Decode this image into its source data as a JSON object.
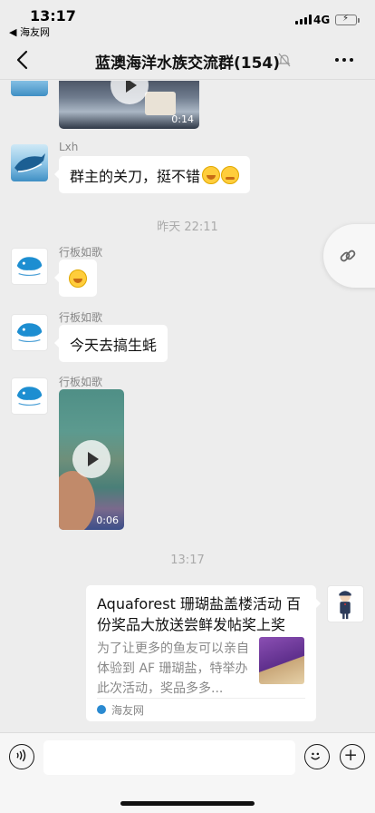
{
  "status_bar": {
    "time": "13:17",
    "back_app": "◀ 海友网",
    "network": "4G",
    "battery_color": "#3ec553"
  },
  "nav": {
    "title": "蓝澳海洋水族交流群(154)",
    "back_icon": "chevron-left-icon",
    "mute_icon": "bell-off-icon",
    "more_icon": "more-dots-icon"
  },
  "messages": [
    {
      "type": "video",
      "duration": "0:14"
    },
    {
      "type": "text",
      "sender": "Lxh",
      "text": "群主的关刀，挺不错",
      "emojis": [
        "grimace-emoji",
        "dizzy-emoji"
      ]
    },
    {
      "type": "timestamp",
      "text": "昨天 22:11"
    },
    {
      "type": "emoji",
      "sender": "行板如歌",
      "emoji": "grimace-emoji"
    },
    {
      "type": "text",
      "sender": "行板如歌",
      "text": "今天去搞生蚝"
    },
    {
      "type": "video",
      "sender": "行板如歌",
      "duration": "0:06"
    },
    {
      "type": "timestamp",
      "text": "13:17"
    }
  ],
  "card": {
    "title": "Aquaforest 珊瑚盐盖楼活动 百份奖品大放送尝鲜发帖奖上奖",
    "description": "为了让更多的鱼友可以亲自体验到 AF 珊瑚盐，特举办此次活动，奖品多多...",
    "source": "海友网"
  },
  "floating_link_icon": "link-icon",
  "input_bar": {
    "placeholder": "",
    "voice_icon": "voice-icon",
    "emoji_icon": "smile-icon",
    "plus_icon": "plus-icon"
  }
}
